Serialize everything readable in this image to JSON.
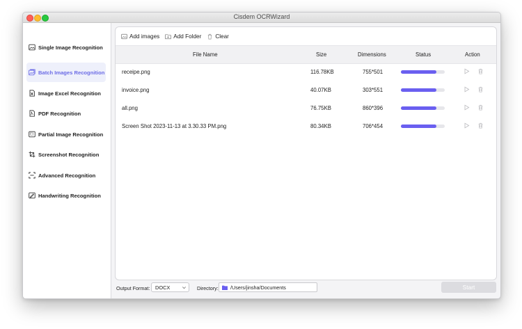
{
  "window": {
    "title": "Cisdem OCRWizard"
  },
  "sidebar": {
    "items": [
      {
        "label": "Single Image Recognition",
        "icon": "image-icon"
      },
      {
        "label": "Batch Images Recognition",
        "icon": "images-icon",
        "active": true
      },
      {
        "label": "Image Excel Recognition",
        "icon": "excel-icon"
      },
      {
        "label": "PDF Recognition",
        "icon": "pdf-icon"
      },
      {
        "label": "Partial Image Recognition",
        "icon": "partial-image-icon"
      },
      {
        "label": "Screenshot Recognition",
        "icon": "screenshot-icon"
      },
      {
        "label": "Advanced Recognition",
        "icon": "advanced-icon"
      },
      {
        "label": "Handwriting Recognition",
        "icon": "handwriting-icon"
      }
    ]
  },
  "toolbar": {
    "add_images": "Add images",
    "add_folder": "Add Folder",
    "clear": "Clear"
  },
  "table": {
    "columns": [
      "File Name",
      "Size",
      "Dimensions",
      "Status",
      "Action"
    ],
    "rows": [
      {
        "name": "receipe.png",
        "size": "116.78KB",
        "dimensions": "755*501",
        "progress": 0.81
      },
      {
        "name": "invoice.png",
        "size": "40.07KB",
        "dimensions": "303*551",
        "progress": 0.81
      },
      {
        "name": "all.png",
        "size": "76.75KB",
        "dimensions": "860*396",
        "progress": 0.81
      },
      {
        "name": "Screen Shot 2023-11-13 at 3.30.33 PM.png",
        "size": "80.34KB",
        "dimensions": "706*454",
        "progress": 0.81
      }
    ]
  },
  "footer": {
    "output_format_label": "Output Format:",
    "output_format_value": "DOCX",
    "directory_label": "Directory:",
    "directory_value": "/Users/jinsha/Documents",
    "start_label": "Start"
  },
  "colors": {
    "accent": "#6a5ff0",
    "active_bg": "#eef0fb",
    "active_text": "#6c6ce6"
  }
}
